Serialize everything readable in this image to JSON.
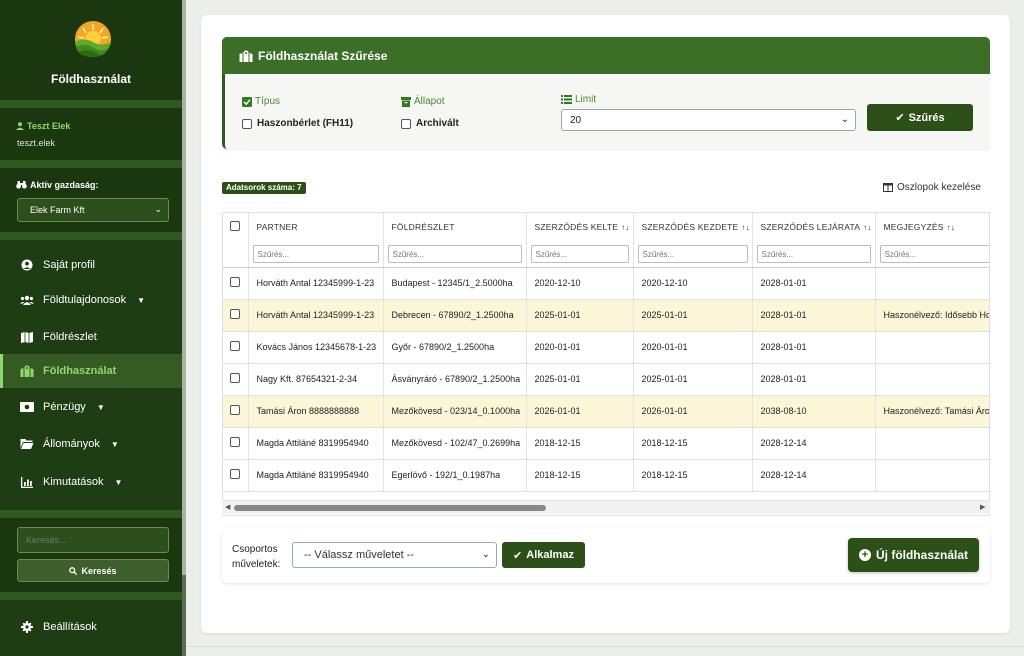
{
  "brand": {
    "title": "Földhasználat"
  },
  "user": {
    "name": "Teszt Elek",
    "login": "teszt.elek"
  },
  "farm": {
    "label": "Aktív gazdaság:",
    "selected": "Elek Farm Kft"
  },
  "nav": [
    {
      "label": "Saját profil",
      "icon": "user-circle-icon",
      "caret": false,
      "active": false
    },
    {
      "label": "Földtulajdonosok",
      "icon": "users-icon",
      "caret": true,
      "active": false
    },
    {
      "label": "Földrészlet",
      "icon": "map-icon",
      "caret": false,
      "active": false
    },
    {
      "label": "Földhasználat",
      "icon": "map-location-icon",
      "caret": false,
      "active": true
    },
    {
      "label": "Pénzügy",
      "icon": "money-icon",
      "caret": true,
      "active": false
    },
    {
      "label": "Állományok",
      "icon": "folder-icon",
      "caret": true,
      "active": false
    },
    {
      "label": "Kimutatások",
      "icon": "chart-icon",
      "caret": true,
      "active": false
    }
  ],
  "sidebar_search": {
    "placeholder": "Keresés...",
    "button": "Keresés"
  },
  "settings": {
    "label": "Beállítások"
  },
  "filter": {
    "title": "Földhasználat Szűrése",
    "type_label": "Típus",
    "type_option": "Haszonbérlet (FH11)",
    "status_label": "Állapot",
    "status_option": "Archivált",
    "limit_label": "Limit",
    "limit_value": "20",
    "button": "Szűrés"
  },
  "count_badge": "Adatsorok száma: 7",
  "columns_link": "Oszlopok kezelése",
  "table": {
    "headers": [
      "PARTNER",
      "FÖLDRÉSZLET",
      "SZERZŐDÉS KELTE",
      "SZERZŐDÉS KEZDETE",
      "SZERZŐDÉS LEJÁRATA",
      "MEGJEGYZÉS"
    ],
    "filter_placeholder": "Szűrés...",
    "rows": [
      [
        "Horváth Antal 12345999-1-23",
        "Budapest - 12345/1_2.5000ha",
        "2020-12-10",
        "2020-12-10",
        "2028-01-01",
        ""
      ],
      [
        "Horváth Antal 12345999-1-23",
        "Debrecen - 67890/2_1.2500ha",
        "2025-01-01",
        "2025-01-01",
        "2028-01-01",
        "Haszonélvező: Idősebb Ho"
      ],
      [
        "Kovács János 12345678-1-23",
        "Győr - 67890/2_1.2500ha",
        "2020-01-01",
        "2020-01-01",
        "2028-01-01",
        ""
      ],
      [
        "Nagy Kft. 87654321-2-34",
        "Ásványráró - 67890/2_1.2500ha",
        "2025-01-01",
        "2025-01-01",
        "2028-01-01",
        ""
      ],
      [
        "Tamási Áron 8888888888",
        "Mezőkövesd - 023/14_0.1000ha",
        "2026-01-01",
        "2026-01-01",
        "2038-08-10",
        "Haszonélvező: Tamási Áron"
      ],
      [
        "Magda Attiláné 8319954940",
        "Mezőkövesd - 102/47_0.2699ha",
        "2018-12-15",
        "2018-12-15",
        "2028-12-14",
        ""
      ],
      [
        "Magda Attiláné 8319954940",
        "Egerlövő - 192/1_0.1987ha",
        "2018-12-15",
        "2018-12-15",
        "2028-12-14",
        ""
      ]
    ],
    "highlighted_rows": [
      1,
      4
    ]
  },
  "bulk": {
    "label": "Csoportos műveletek:",
    "select_value": "-- Válassz műveletet --",
    "apply": "Alkalmaz"
  },
  "new_button": "Új földhasználat",
  "colors": {
    "sidebar": "#1f3d13",
    "accent": "#3b6e27",
    "button": "#2d5019",
    "active": "#8fd86c",
    "highlight": "#fcf6d8"
  }
}
